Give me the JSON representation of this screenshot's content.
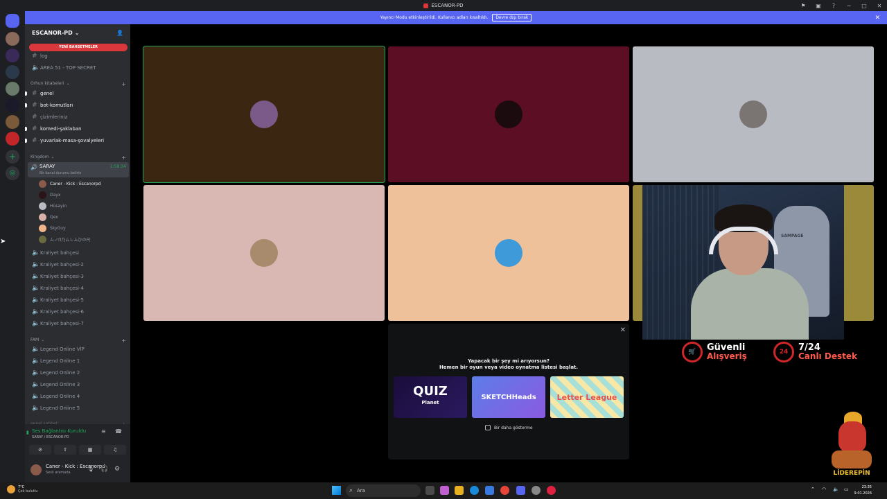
{
  "window": {
    "title": "ESCANOR-PD",
    "controls": [
      "−",
      "□",
      "✕"
    ]
  },
  "banner": {
    "text": "Yayıncı Modu etkinleştirildi. Kullanıcı adları kısaltıldı.",
    "button": "Devre dışı bırak"
  },
  "guild": {
    "name": "ESCANOR-PD",
    "new_mentions": "YENİ BAHSETMELER"
  },
  "channels_top": [
    "log",
    "AREA 51 - TOP SECRET"
  ],
  "categories": {
    "orhun": "Orhun kitabeleri",
    "kingdom": "Kingdom",
    "fam": "FAM",
    "last": "genel sohbet"
  },
  "text_channels": [
    {
      "name": "genel",
      "unread": true
    },
    {
      "name": "bot-komutları",
      "unread": true
    },
    {
      "name": "çizimleriniz",
      "unread": false
    },
    {
      "name": "komedi-şaklaban",
      "unread": true
    },
    {
      "name": "yuvarlak-masa-şovalyeleri",
      "unread": true
    }
  ],
  "active_voice": {
    "name": "SARAY",
    "timer": "2:58:34",
    "subtitle": "Bir kanal durumu belirle"
  },
  "voice_users": [
    {
      "name": "Caner - Kick : Escanorpd",
      "me": true,
      "color": "#8a5a4a"
    },
    {
      "name": "Dayx",
      "me": false,
      "color": "#2a1418"
    },
    {
      "name": "Hüsayin",
      "me": false,
      "color": "#b8bcc2"
    },
    {
      "name": "Qex",
      "me": false,
      "color": "#d9b0a8"
    },
    {
      "name": "SkyGuy",
      "me": false,
      "color": "#f0b48a"
    },
    {
      "name": "ムノΠ乃ムレムひの尺",
      "me": false,
      "color": "#6a6a40"
    }
  ],
  "kingdom_channels": [
    "Kraliyet bahçesi",
    "Kraliyet bahçesi-2",
    "Kraliyet bahçesi-3",
    "Kraliyet bahçesi-4",
    "Kraliyet bahçesi-5",
    "Kraliyet bahçesi-6",
    "Kraliyet bahçesi-7"
  ],
  "fam_channels": [
    "Legend Online VİP",
    "Legend Online 1",
    "Legend Online 2",
    "Legend Online 3",
    "Legend Online 4",
    "Legend Online 5"
  ],
  "voice_panel": {
    "status": "Ses Bağlantısı Kuruldu",
    "location": "SARAY / ESCANOR-PD"
  },
  "user": {
    "name": "Caner - Kick : Escanorpd",
    "status": "Sesli aramada"
  },
  "tiles": [
    {
      "bg": "#3b2612",
      "avatar": "#7b5a8a",
      "speaking": true
    },
    {
      "bg": "#5c0f24",
      "avatar": "#1b0a0e",
      "speaking": false
    },
    {
      "bg": "#b8bcc2",
      "avatar": "#7a7472",
      "speaking": false
    },
    {
      "bg": "#d9b8b4",
      "avatar": "#a88a6c",
      "speaking": false
    },
    {
      "bg": "#efc19b",
      "avatar": "#3e9ad8",
      "speaking": false
    },
    {
      "bg": "#9a8a3a",
      "avatar": "#6a6a40",
      "speaking": false
    }
  ],
  "cam": {
    "chair_brand": "SAMPAGE"
  },
  "ads": [
    {
      "icon": "🛒",
      "line1": "Güvenli",
      "line2": "Alışveriş"
    },
    {
      "icon": "24",
      "line1": "7/24",
      "line2": "Canlı Destek"
    }
  ],
  "popup": {
    "title": "Yapacak bir şey mi arıyorsun?",
    "subtitle": "Hemen bir oyun veya video oynatma listesi başlat.",
    "games": [
      "QUIZ",
      "SKETCHHeads",
      "Letter League"
    ],
    "quiz_sub": "Planet",
    "checkbox": "Bir daha gösterme"
  },
  "mascot": {
    "label": "LİDEREPİN"
  },
  "taskbar": {
    "temp": "7°C",
    "weather": "Çok bulutlu",
    "search": "Ara",
    "time": "23:35",
    "date": "9.01.2026"
  },
  "colors": {
    "accent": "#5865f2",
    "online": "#23a55a",
    "danger": "#da373c"
  }
}
